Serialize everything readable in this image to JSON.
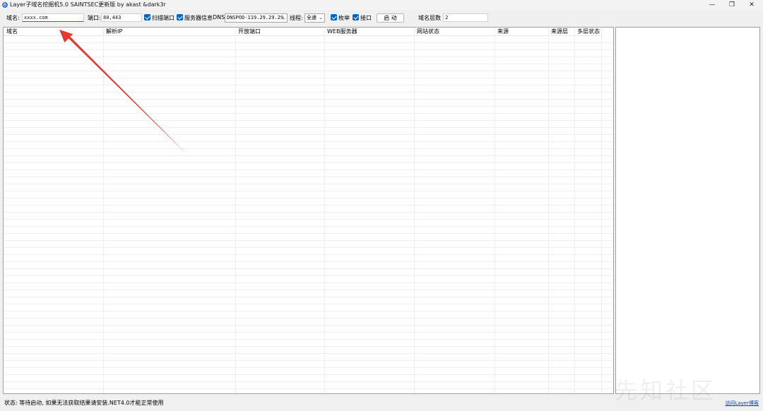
{
  "window": {
    "title": "Layer子域名挖掘机5.0 SAINTSEC更新版 by akast &dark3r",
    "minimize_glyph": "—",
    "restore_glyph": "❐",
    "close_glyph": "✕"
  },
  "toolbar": {
    "domain_label": "域名:",
    "domain_value": "xxxx.com",
    "port_label": "端口:",
    "port_value": "80,443",
    "scan_port_label": "扫描端口",
    "scan_port_checked": true,
    "server_info_label": "服务器信息",
    "server_info_checked": true,
    "dns_label": "DNS:",
    "dns_value": "DNSPOD-119.29.29.29",
    "thread_label": "线程:",
    "thread_value": "全速",
    "enumerate_label": "枚举",
    "enumerate_checked": true,
    "interface_label": "接口",
    "interface_checked": true,
    "start_button": "启 动",
    "depth_label": "域名层数",
    "depth_value": "2"
  },
  "grid": {
    "columns": [
      "域名",
      "解析IP",
      "开放端口",
      "WEB服务器",
      "网站状态",
      "来源",
      "来源层",
      "多层状态"
    ]
  },
  "status": {
    "text": "状态: 等待启动, 如果无法获取结果请安装.NET4.0才能正常使用",
    "link": "访问Layer博客"
  },
  "watermark": "先知社区",
  "colors": {
    "checkbox": "#0067c0",
    "annotation_arrow": "#e8372c",
    "link": "#0645ad"
  }
}
